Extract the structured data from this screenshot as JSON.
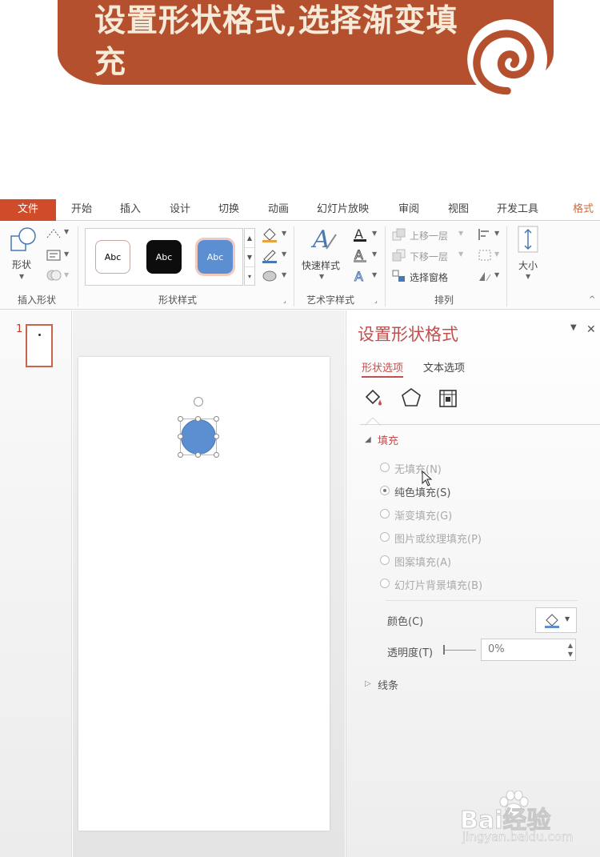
{
  "banner": {
    "title": "设置形状格式,选择渐变填充"
  },
  "ribbon": {
    "tabs": [
      {
        "label": "文件"
      },
      {
        "label": "开始"
      },
      {
        "label": "插入"
      },
      {
        "label": "设计"
      },
      {
        "label": "切换"
      },
      {
        "label": "动画"
      },
      {
        "label": "幻灯片放映"
      },
      {
        "label": "审阅"
      },
      {
        "label": "视图"
      },
      {
        "label": "开发工具"
      },
      {
        "label": "格式"
      }
    ],
    "insert_shapes": {
      "shape_label": "形状",
      "group_label": "插入形状"
    },
    "shape_styles": {
      "swatches": [
        {
          "label": "Abc",
          "fill": "#ffffff",
          "text": "#333333"
        },
        {
          "label": "Abc",
          "fill": "#0d0d0d",
          "text": "#ffffff"
        },
        {
          "label": "Abc",
          "fill": "#5b8fd1",
          "text": "#ffffff"
        }
      ],
      "group_label": "形状样式"
    },
    "wordart": {
      "quick_styles_label": "快速样式",
      "group_label": "艺术字样式"
    },
    "arrange": {
      "bring_forward": "上移一层",
      "send_backward": "下移一层",
      "selection_pane": "选择窗格",
      "group_label": "排列"
    },
    "size": {
      "label": "大小"
    }
  },
  "slides": {
    "thumb_number": "1"
  },
  "format_pane": {
    "title": "设置形状格式",
    "tabs": [
      {
        "label": "形状选项",
        "active": true
      },
      {
        "label": "文本选项",
        "active": false
      }
    ],
    "icons": [
      "fill-line-icon",
      "effects-pentagon-icon",
      "size-properties-icon"
    ],
    "fill_section": {
      "label": "填充",
      "options": [
        {
          "label": "无填充(N)",
          "checked": false
        },
        {
          "label": "纯色填充(S)",
          "checked": true
        },
        {
          "label": "渐变填充(G)",
          "checked": false
        },
        {
          "label": "图片或纹理填充(P)",
          "checked": false
        },
        {
          "label": "图案填充(A)",
          "checked": false
        },
        {
          "label": "幻灯片背景填充(B)",
          "checked": false
        }
      ],
      "color_label": "颜色(C)",
      "transparency_label": "透明度(T)",
      "transparency_value": "0%"
    },
    "line_section": {
      "label": "线条"
    }
  },
  "watermark": {
    "brand": "Bai经验",
    "url": "jingyan.baidu.com"
  },
  "colors": {
    "banner": "#b5502f",
    "accent": "#c0504d",
    "file_tab": "#cf4b2a",
    "shape_fill": "#5b8fd1"
  }
}
